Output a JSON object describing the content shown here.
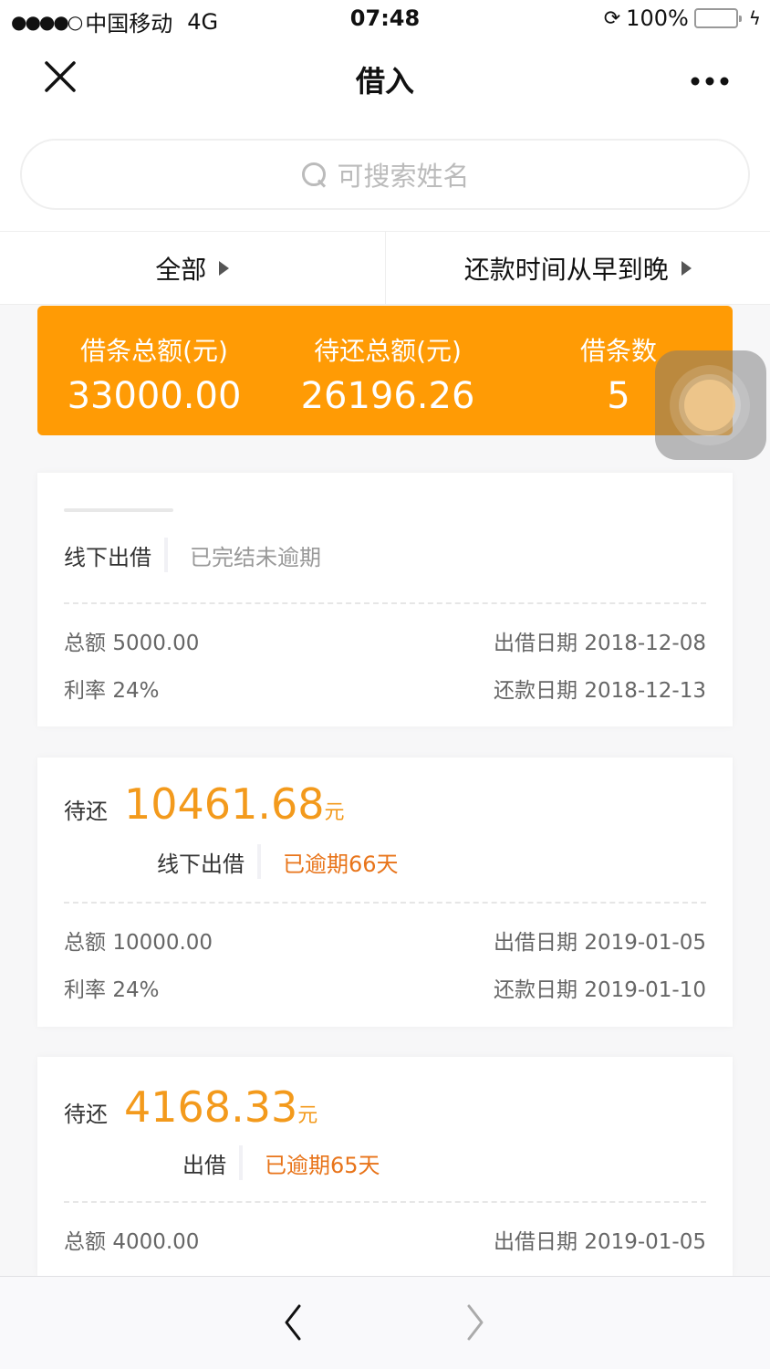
{
  "status_bar": {
    "signal": "●●●●○",
    "carrier": "中国移动",
    "network": "4G",
    "time": "07:48",
    "battery_pct": "100%"
  },
  "nav": {
    "title": "借入",
    "close_icon": "close-icon",
    "more_icon": "more-icon"
  },
  "search": {
    "placeholder": "可搜索姓名"
  },
  "filters": [
    {
      "label": "全部"
    },
    {
      "label": "还款时间从早到晚"
    }
  ],
  "summary": {
    "total_label": "借条总额(元)",
    "total_value": "33000.00",
    "due_label": "待还总额(元)",
    "due_value": "26196.26",
    "count_label": "借条数",
    "count_value": "5"
  },
  "loans": [
    {
      "type": "线下出借",
      "status": "已完结未逾期",
      "total_label": "总额",
      "total": "5000.00",
      "rate_label": "利率",
      "rate": "24%",
      "lend_date_label": "出借日期",
      "lend_date": "2018-12-08",
      "repay_date_label": "还款日期",
      "repay_date": "2018-12-13"
    },
    {
      "due_label": "待还",
      "due_amount": "10461.68",
      "due_unit": "元",
      "type": "线下出借",
      "status": "已逾期66天",
      "total_label": "总额",
      "total": "10000.00",
      "rate_label": "利率",
      "rate": "24%",
      "lend_date_label": "出借日期",
      "lend_date": "2019-01-05",
      "repay_date_label": "还款日期",
      "repay_date": "2019-01-10"
    },
    {
      "due_label": "待还",
      "due_amount": "4168.33",
      "due_unit": "元",
      "type": "出借",
      "status": "已逾期65天",
      "total_label": "总额",
      "total": "4000.00",
      "lend_date_label": "出借日期",
      "lend_date": "2019-01-05"
    }
  ],
  "toolbar": {
    "back_icon": "chevron-left-icon",
    "forward_icon": "chevron-right-icon"
  }
}
